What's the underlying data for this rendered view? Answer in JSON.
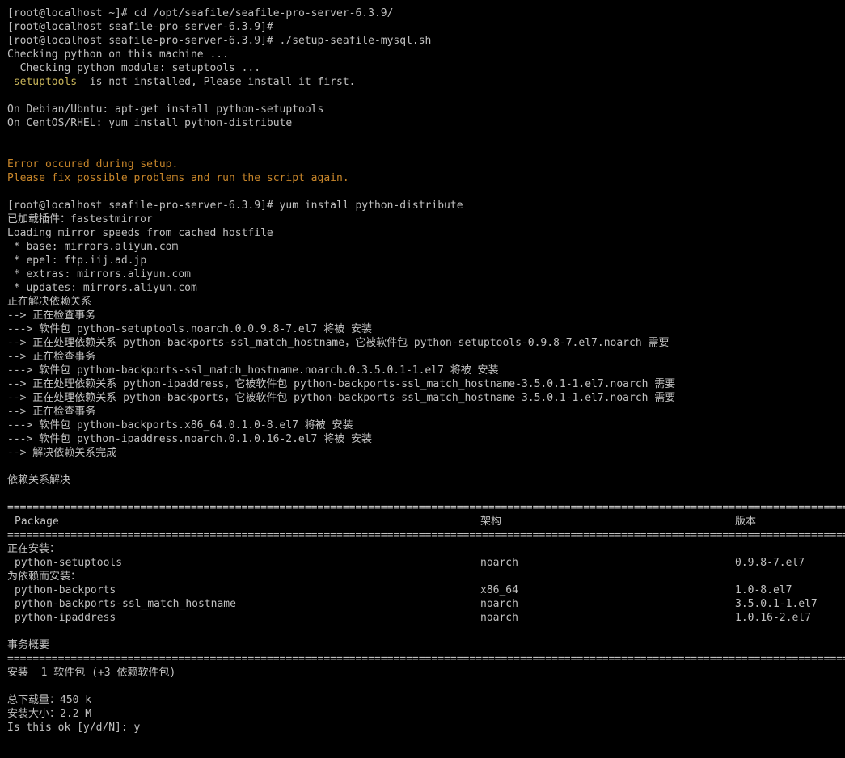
{
  "terminal": {
    "bg": "#000000",
    "fg": "#c0c0c0",
    "error_color": "#c8862a",
    "prompt_line1": "[root@localhost ~]# cd /opt/seafile/seafile-pro-server-6.3.9/",
    "prompt_line2": "[root@localhost seafile-pro-server-6.3.9]#",
    "prompt_line3": "[root@localhost seafile-pro-server-6.3.9]# ./setup-seafile-mysql.sh",
    "checking_python": "Checking python on this machine ...",
    "checking_module": "  Checking python module: setuptools ...",
    "setuptools_word": "setuptools",
    "not_installed": "  is not installed, Please install it first.",
    "debian": "On Debian/Ubntu: apt-get install python-setuptools",
    "centos": "On CentOS/RHEL: yum install python-distribute",
    "error1": "Error occured during setup.",
    "error2": "Please fix possible problems and run the script again.",
    "prompt_yum": "[root@localhost seafile-pro-server-6.3.9]# yum install python-distribute",
    "plugins": "已加载插件：fastestmirror",
    "loading_mirror": "Loading mirror speeds from cached hostfile",
    "mirror_base": " * base: mirrors.aliyun.com",
    "mirror_epel": " * epel: ftp.iij.ad.jp",
    "mirror_extras": " * extras: mirrors.aliyun.com",
    "mirror_updates": " * updates: mirrors.aliyun.com",
    "resolving": "正在解决依赖关系",
    "checking_tx1": "--> 正在检查事务",
    "pkg1": "---> 软件包 python-setuptools.noarch.0.0.9.8-7.el7 将被 安装",
    "dep1": "--> 正在处理依赖关系 python-backports-ssl_match_hostname，它被软件包 python-setuptools-0.9.8-7.el7.noarch 需要",
    "checking_tx2": "--> 正在检查事务",
    "pkg2": "---> 软件包 python-backports-ssl_match_hostname.noarch.0.3.5.0.1-1.el7 将被 安装",
    "dep2": "--> 正在处理依赖关系 python-ipaddress，它被软件包 python-backports-ssl_match_hostname-3.5.0.1-1.el7.noarch 需要",
    "dep3": "--> 正在处理依赖关系 python-backports，它被软件包 python-backports-ssl_match_hostname-3.5.0.1-1.el7.noarch 需要",
    "checking_tx3": "--> 正在检查事务",
    "pkg3": "---> 软件包 python-backports.x86_64.0.1.0-8.el7 将被 安装",
    "pkg4": "---> 软件包 python-ipaddress.noarch.0.1.0.16-2.el7 将被 安装",
    "resolve_done": "--> 解决依赖关系完成",
    "deps_resolved": "依赖关系解决",
    "separator": "==========================================================================================================================================================================================================================================",
    "table_headers": [
      "Package",
      "架构",
      "版本"
    ],
    "installing_label": "正在安装：",
    "installing_rows": [
      {
        "pkg": "python-setuptools",
        "arch": "noarch",
        "ver": "0.9.8-7.el7"
      }
    ],
    "dep_install_label": "为依赖而安装：",
    "dep_rows": [
      {
        "pkg": "python-backports",
        "arch": "x86_64",
        "ver": "1.0-8.el7"
      },
      {
        "pkg": "python-backports-ssl_match_hostname",
        "arch": "noarch",
        "ver": "3.5.0.1-1.el7"
      },
      {
        "pkg": "python-ipaddress",
        "arch": "noarch",
        "ver": "1.0.16-2.el7"
      }
    ],
    "tx_summary": "事务概要",
    "install_count": "安装  1 软件包 (+3 依赖软件包)",
    "total_download": "总下载量：450 k",
    "install_size": "安装大小：2.2 M",
    "confirm_prompt": "Is this ok [y/d/N]: y"
  }
}
